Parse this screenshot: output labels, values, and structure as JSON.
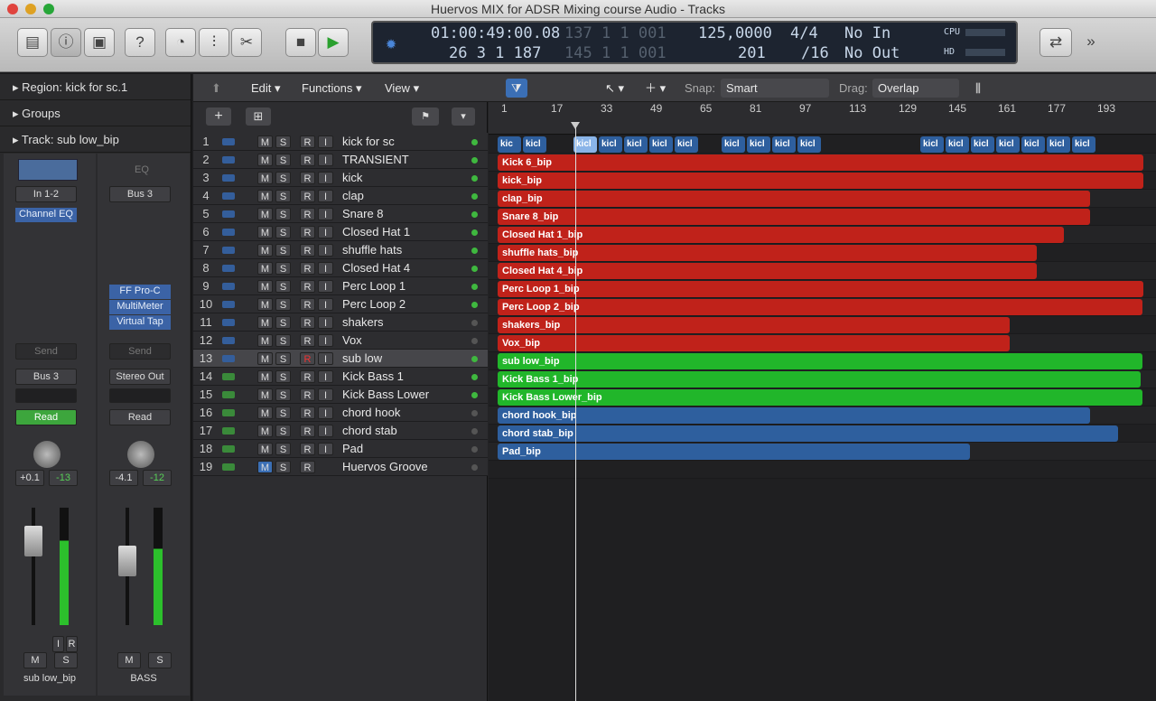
{
  "window": {
    "title": "Huervos MIX for ADSR Mixing course Audio - Tracks"
  },
  "lcd": {
    "time": "01:00:49:00.08",
    "bars": "26  3  1  187",
    "ghost1": "137  1  1  001",
    "ghost2": "145  1  1  001",
    "tempo": "125,0000",
    "sig_top": "4/4",
    "sig_bottom": "/16",
    "bpm2": "201",
    "midi_in": "No In",
    "midi_out": "No Out",
    "cpu": "CPU",
    "hd": "HD"
  },
  "inspector": {
    "region": "Region:  kick for sc.1",
    "groups": "Groups",
    "track": "Track:  sub low_bip",
    "ch1": {
      "input": "In 1-2",
      "eq": "Channel EQ",
      "send": "Send",
      "output": "Bus 3",
      "mode": "Read",
      "pan_val": "+0.1",
      "gain": "-13",
      "name": "sub low_bip",
      "m": "M",
      "s": "S",
      "i": "I",
      "r": "R"
    },
    "ch2": {
      "eq_label": "EQ",
      "input": "Bus 3",
      "plugins": [
        "FF Pro-C",
        "MultiMeter",
        "Virtual Tap"
      ],
      "send": "Send",
      "output": "Stereo Out",
      "mode": "Read",
      "pan_val": "-4.1",
      "gain": "-12",
      "name": "BASS",
      "m": "M",
      "s": "S"
    }
  },
  "menus": {
    "edit": "Edit",
    "functions": "Functions",
    "view": "View",
    "snap_label": "Snap:",
    "snap": "Smart",
    "drag_label": "Drag:",
    "drag": "Overlap"
  },
  "ruler": [
    "1",
    "17",
    "33",
    "49",
    "65",
    "81",
    "97",
    "113",
    "129",
    "145",
    "161",
    "177",
    "193"
  ],
  "tracks": [
    {
      "n": "1",
      "name": "kick for sc",
      "m": "M",
      "s": "S",
      "r": "R",
      "i": "I"
    },
    {
      "n": "2",
      "name": "TRANSIENT",
      "m": "M",
      "s": "S",
      "r": "R",
      "i": "I"
    },
    {
      "n": "3",
      "name": "kick",
      "m": "M",
      "s": "S",
      "r": "R",
      "i": "I"
    },
    {
      "n": "4",
      "name": "clap",
      "m": "M",
      "s": "S",
      "r": "R",
      "i": "I"
    },
    {
      "n": "5",
      "name": "Snare 8",
      "m": "M",
      "s": "S",
      "r": "R",
      "i": "I"
    },
    {
      "n": "6",
      "name": "Closed Hat 1",
      "m": "M",
      "s": "S",
      "r": "R",
      "i": "I"
    },
    {
      "n": "7",
      "name": "shuffle hats",
      "m": "M",
      "s": "S",
      "r": "R",
      "i": "I"
    },
    {
      "n": "8",
      "name": "Closed Hat 4",
      "m": "M",
      "s": "S",
      "r": "R",
      "i": "I"
    },
    {
      "n": "9",
      "name": "Perc Loop 1",
      "m": "M",
      "s": "S",
      "r": "R",
      "i": "I"
    },
    {
      "n": "10",
      "name": "Perc Loop 2",
      "m": "M",
      "s": "S",
      "r": "R",
      "i": "I"
    },
    {
      "n": "11",
      "name": "shakers",
      "m": "M",
      "s": "S",
      "r": "R",
      "i": "I"
    },
    {
      "n": "12",
      "name": "Vox",
      "m": "M",
      "s": "S",
      "r": "R",
      "i": "I"
    },
    {
      "n": "13",
      "name": "sub low",
      "m": "M",
      "s": "S",
      "r": "R",
      "i": "I"
    },
    {
      "n": "14",
      "name": "Kick Bass 1",
      "m": "M",
      "s": "S",
      "r": "R",
      "i": "I"
    },
    {
      "n": "15",
      "name": "Kick Bass Lower",
      "m": "M",
      "s": "S",
      "r": "R",
      "i": "I"
    },
    {
      "n": "16",
      "name": "chord hook",
      "m": "M",
      "s": "S",
      "r": "R",
      "i": "I"
    },
    {
      "n": "17",
      "name": "chord stab",
      "m": "M",
      "s": "S",
      "r": "R",
      "i": "I"
    },
    {
      "n": "18",
      "name": "Pad",
      "m": "M",
      "s": "S",
      "r": "R",
      "i": "I"
    },
    {
      "n": "19",
      "name": "Huervos Groove",
      "m": "M",
      "s": "S",
      "r": "R",
      "i": ""
    }
  ],
  "regions": [
    {
      "row": 1,
      "label": "Kick 6_bip",
      "color": "#c0221a",
      "end": 0.995
    },
    {
      "row": 2,
      "label": "kick_bip",
      "color": "#c0221a",
      "end": 0.995
    },
    {
      "row": 3,
      "label": "clap_bip",
      "color": "#c0221a",
      "end": 0.912
    },
    {
      "row": 4,
      "label": "Snare 8_bip",
      "color": "#c0221a",
      "end": 0.912
    },
    {
      "row": 5,
      "label": "Closed Hat 1_bip",
      "color": "#c0221a",
      "end": 0.872
    },
    {
      "row": 6,
      "label": "shuffle hats_bip",
      "color": "#c0221a",
      "end": 0.83
    },
    {
      "row": 7,
      "label": "Closed Hat 4_bip",
      "color": "#c0221a",
      "end": 0.83
    },
    {
      "row": 8,
      "label": "Perc Loop 1_bip",
      "color": "#c0221a",
      "end": 0.995
    },
    {
      "row": 9,
      "label": "Perc Loop 2_bip",
      "color": "#c0221a",
      "end": 0.993
    },
    {
      "row": 10,
      "label": "shakers_bip",
      "color": "#c0221a",
      "end": 0.788
    },
    {
      "row": 11,
      "label": "Vox_bip",
      "color": "#c0221a",
      "end": 0.788
    },
    {
      "row": 12,
      "label": "sub low_bip",
      "color": "#21b62a",
      "end": 0.993
    },
    {
      "row": 13,
      "label": "Kick Bass 1_bip",
      "color": "#21b62a",
      "end": 0.99
    },
    {
      "row": 14,
      "label": "Kick Bass Lower_bip",
      "color": "#21b62a",
      "end": 0.993
    },
    {
      "row": 15,
      "label": "chord hook_bip",
      "color": "#2e5f9e",
      "end": 0.912
    },
    {
      "row": 16,
      "label": "chord stab_bip",
      "color": "#2e5f9e",
      "end": 0.955
    },
    {
      "row": 17,
      "label": "Pad_bip",
      "color": "#2e5f9e",
      "end": 0.727
    }
  ],
  "kick_regions": {
    "label": "kic",
    "label2": "kicl",
    "count": 18
  }
}
